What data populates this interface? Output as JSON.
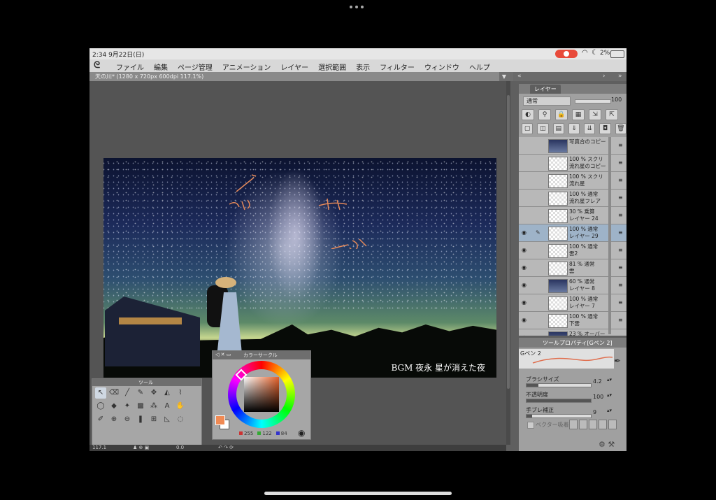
{
  "status": {
    "time": "2:34  9月22日(日)",
    "wifi_icon": "wifi-icon",
    "moon_icon": "moon-icon",
    "battery": "2%"
  },
  "menu": [
    "ファイル",
    "編集",
    "ページ管理",
    "アニメーション",
    "レイヤー",
    "選択範囲",
    "表示",
    "フィルター",
    "ウィンドウ",
    "ヘルプ"
  ],
  "document": {
    "tab_title": "天の川* (1280 x 720px 600dpi 117.1%)"
  },
  "artwork": {
    "caption": "BGM 夜永 星が消えた夜"
  },
  "layer_panel": {
    "tab": "レイヤー",
    "blend_mode": "通常",
    "opacity": "100",
    "layers": [
      {
        "l1": "写真合のコピー",
        "l2": "",
        "thumb": "img",
        "eye": false,
        "selected": false
      },
      {
        "l1": "100 % スクリ",
        "l2": "流れ星のコピー",
        "thumb": "clear",
        "eye": false,
        "selected": false
      },
      {
        "l1": "100 % スクリ",
        "l2": "流れ星",
        "thumb": "clear",
        "eye": false,
        "selected": false
      },
      {
        "l1": "100 % 通常",
        "l2": "流れ星フレア",
        "thumb": "clear",
        "eye": false,
        "selected": false
      },
      {
        "l1": "30 % 乗算",
        "l2": "レイヤー 24",
        "thumb": "clear",
        "eye": false,
        "selected": false
      },
      {
        "l1": "100 % 通常",
        "l2": "レイヤー 29",
        "thumb": "clear",
        "eye": true,
        "selected": true
      },
      {
        "l1": "100 % 通常",
        "l2": "雲2",
        "thumb": "clear",
        "eye": true,
        "selected": false
      },
      {
        "l1": "81 % 通常",
        "l2": "雲",
        "thumb": "clear",
        "eye": true,
        "selected": false
      },
      {
        "l1": "60 % 通常",
        "l2": "レイヤー 8",
        "thumb": "img",
        "eye": true,
        "selected": false
      },
      {
        "l1": "100 % 通常",
        "l2": "レイヤー 7",
        "thumb": "clear",
        "eye": true,
        "selected": false
      },
      {
        "l1": "100 % 通常",
        "l2": "下雲",
        "thumb": "clear",
        "eye": true,
        "selected": false
      },
      {
        "l1": "23 % オーバー",
        "l2": "",
        "thumb": "img",
        "eye": true,
        "selected": false
      }
    ]
  },
  "tool_property": {
    "title": "ツールプロパティ[Gペン 2]",
    "brush_name": "Gペン 2",
    "props": [
      {
        "label": "ブラシサイズ",
        "value": "4.2",
        "fill": 0.18
      },
      {
        "label": "不透明度",
        "value": "100",
        "fill": 1.0
      },
      {
        "label": "手ブレ補正",
        "value": "9",
        "fill": 0.09
      }
    ],
    "vector_label": "ベクター吸着"
  },
  "color_window": {
    "title": "カラーサークル",
    "r": "255",
    "g": "122",
    "b": "84",
    "fg_color": "#f08a54"
  },
  "tool_window": {
    "title": "ツール"
  },
  "bottom": {
    "zoom": "117.1",
    "angle": "0.0"
  }
}
